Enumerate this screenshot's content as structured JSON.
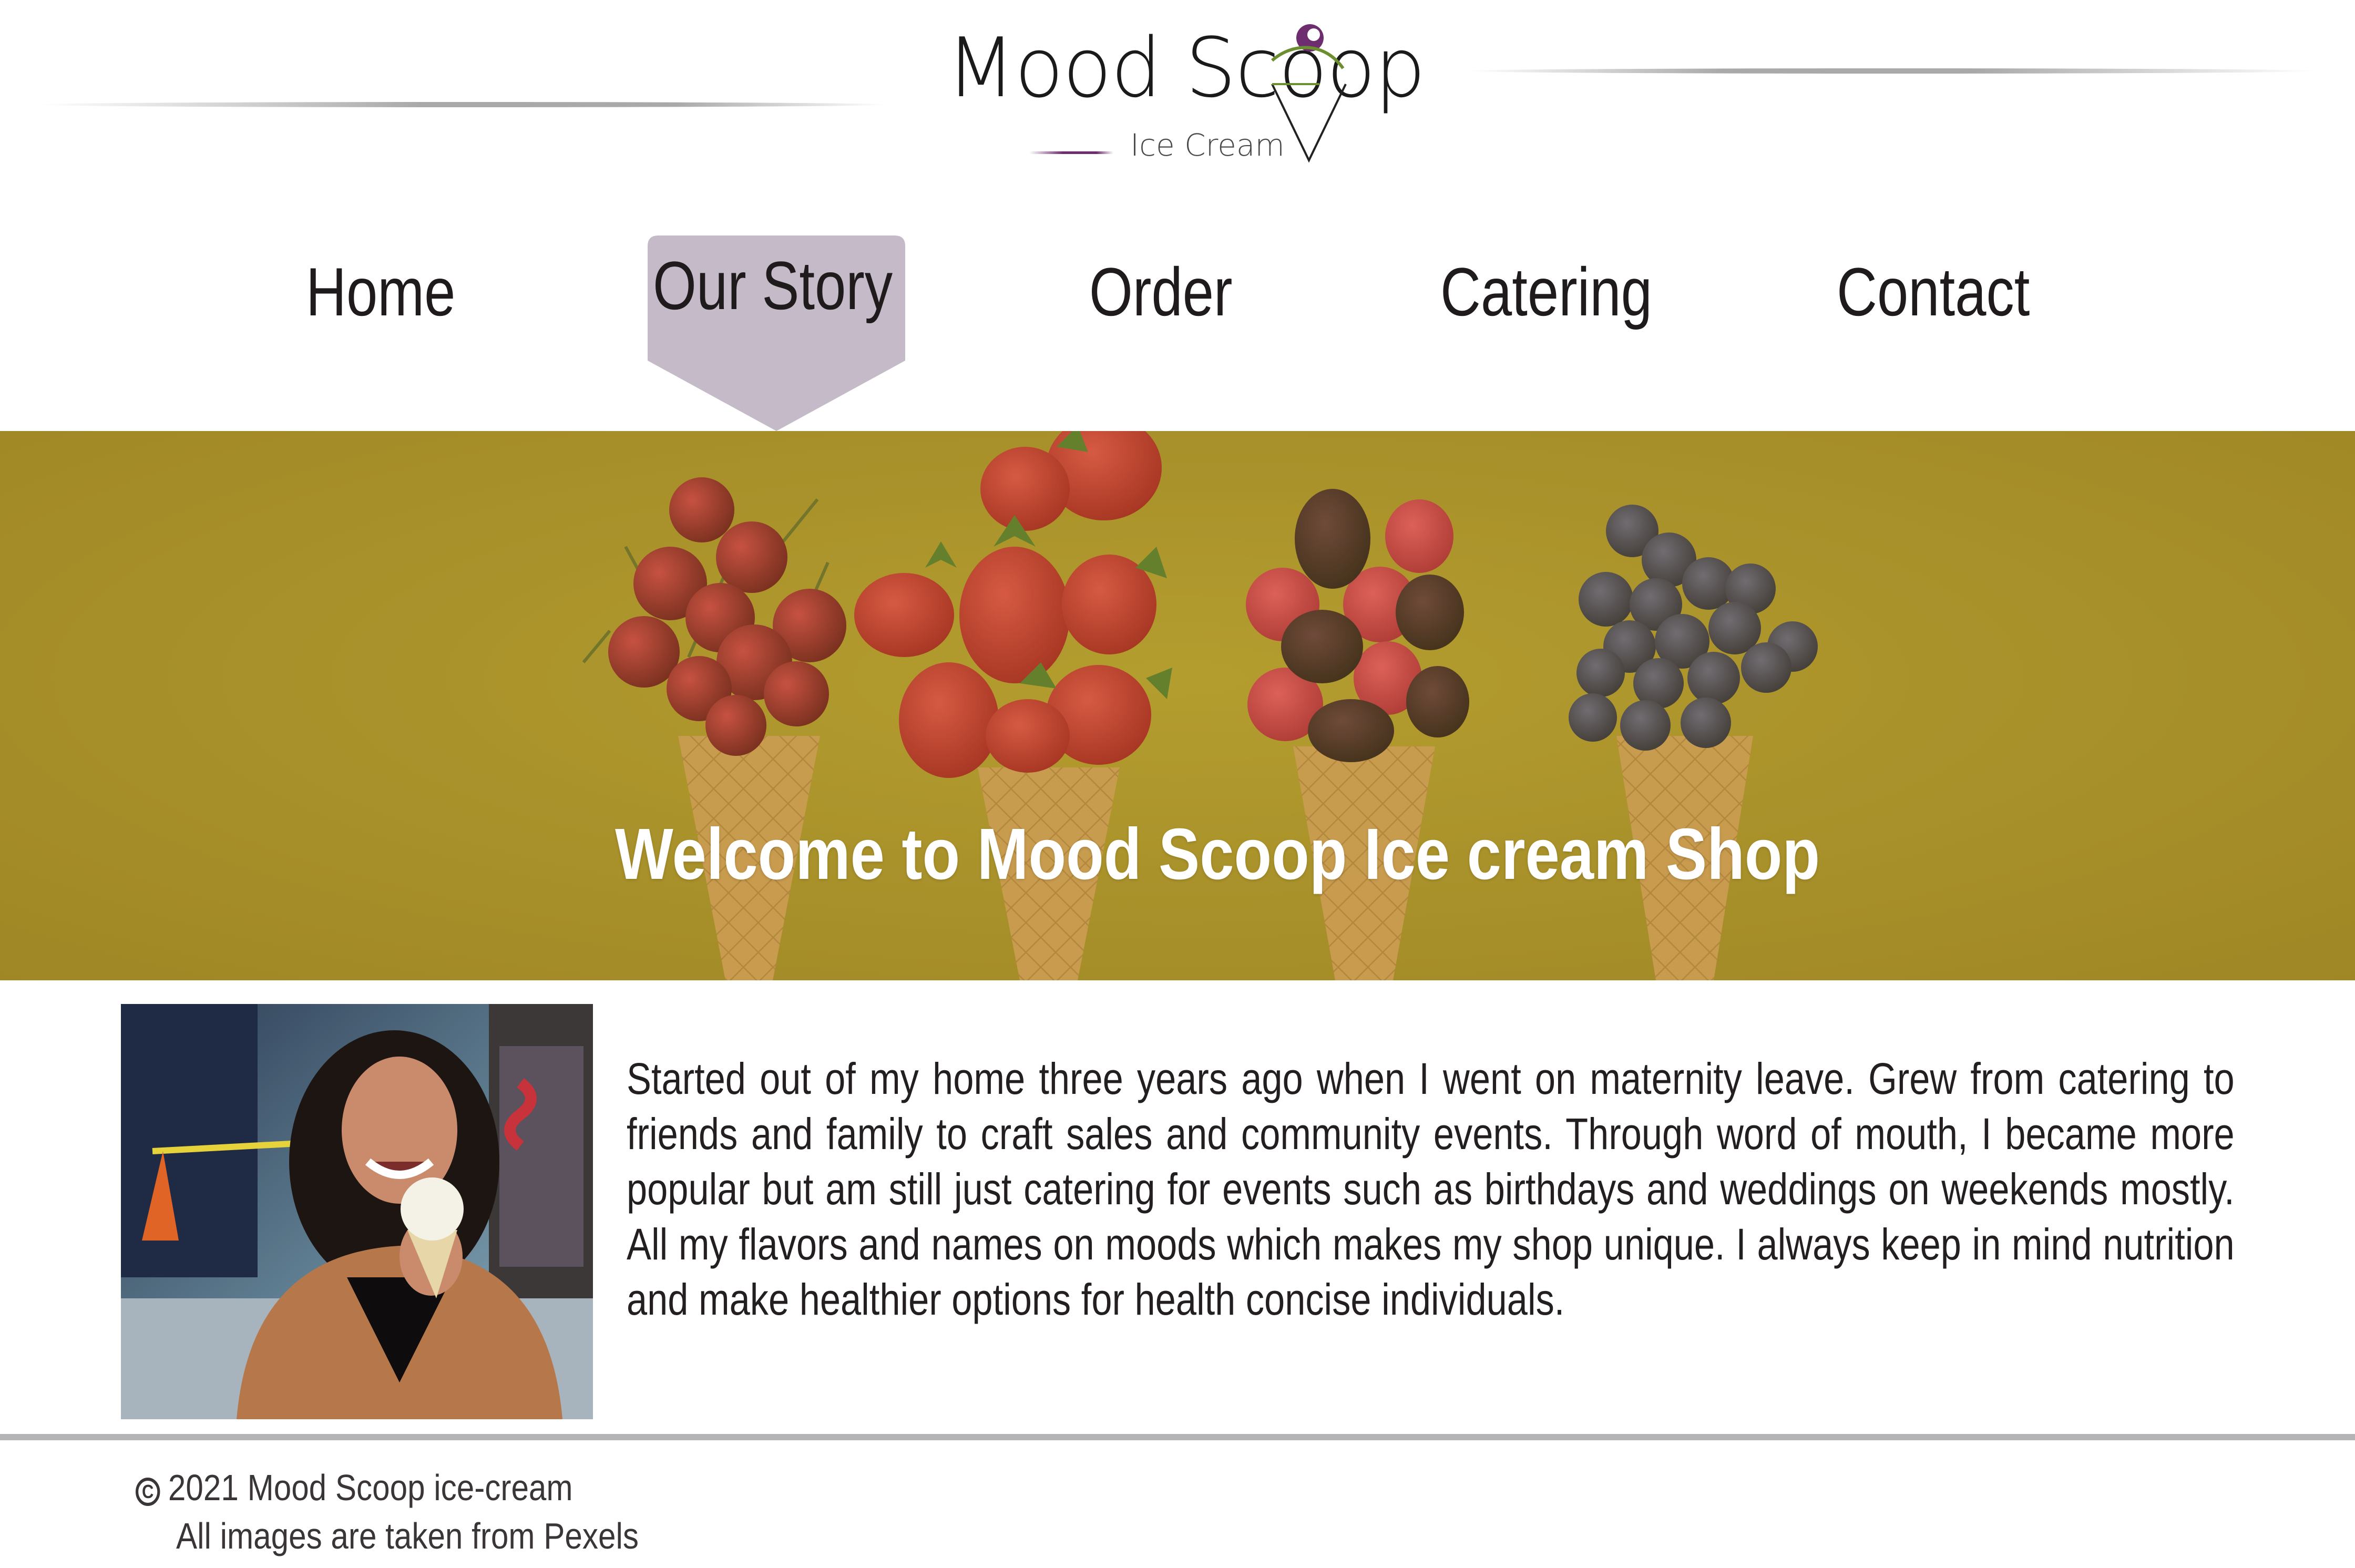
{
  "brand": {
    "name": "Mood Scoop",
    "tagline": "Ice Cream"
  },
  "nav": {
    "items": [
      {
        "label": "Home"
      },
      {
        "label": "Our Story",
        "active": true
      },
      {
        "label": "Order"
      },
      {
        "label": "Catering"
      },
      {
        "label": "Contact"
      }
    ]
  },
  "hero": {
    "title": "Welcome to Mood Scoop Ice cream Shop"
  },
  "story": {
    "text": "Started out of my home three years ago when I went on maternity leave. Grew from catering to friends and family to craft sales and community events. Through word of mouth, I became more popular but am still just catering for events such as birthdays and weddings on weekends mostly. All my flavors and names on moods which makes my shop unique. I always keep in mind nutrition and make healthier options for health concise individuals."
  },
  "footer": {
    "copyright": "2021 Mood Scoop ice-cream",
    "credits": "All images are taken from Pexels"
  },
  "colors": {
    "nav_active": "#c5bac8",
    "hero_overlay": "#a8912a",
    "logo_accent_purple": "#6e2d6e",
    "logo_accent_green": "#6b8e2e",
    "footer_rule": "#b4b4b6"
  }
}
